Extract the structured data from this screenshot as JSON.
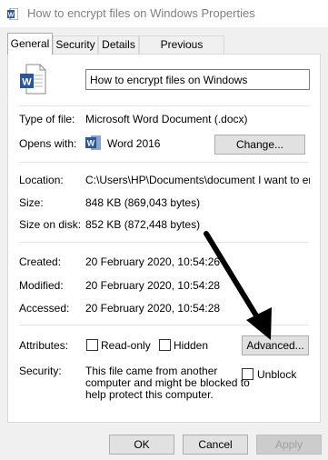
{
  "window": {
    "title": "How to encrypt files on Windows Properties"
  },
  "tabs": [
    "General",
    "Security",
    "Details",
    "Previous Versions"
  ],
  "file": {
    "name": "How to encrypt files on Windows",
    "type_label": "Type of file:",
    "type_value": "Microsoft Word Document (.docx)",
    "opens_label": "Opens with:",
    "opens_value": "Word 2016",
    "change_button": "Change...",
    "location_label": "Location:",
    "location_value": "C:\\Users\\HP\\Documents\\document I want to encry",
    "size_label": "Size:",
    "size_value": "848 KB (869,043 bytes)",
    "size_disk_label": "Size on disk:",
    "size_disk_value": "852 KB (872,448 bytes)",
    "created_label": "Created:",
    "created_value": "20 February 2020, 10:54:26",
    "modified_label": "Modified:",
    "modified_value": "20 February 2020, 10:54:28",
    "accessed_label": "Accessed:",
    "accessed_value": "20 February 2020, 10:54:28"
  },
  "attributes": {
    "label": "Attributes:",
    "readonly": "Read-only",
    "hidden": "Hidden",
    "advanced_button": "Advanced..."
  },
  "security": {
    "label": "Security:",
    "line1": "This file came from another",
    "line2": "computer and might be blocked to",
    "line3": "help protect this computer.",
    "unblock": "Unblock"
  },
  "footer": {
    "ok": "OK",
    "cancel": "Cancel",
    "apply": "Apply"
  },
  "colors": {
    "word_blue": "#2b579a",
    "arrow": "#000000"
  }
}
